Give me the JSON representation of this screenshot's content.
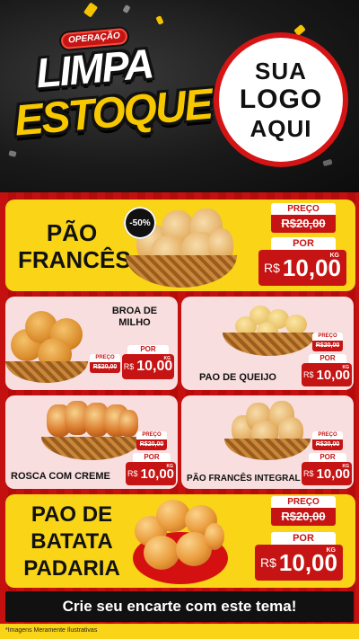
{
  "header": {
    "badge": "OPERAÇÃO",
    "title_line1": "LIMPA",
    "title_line2": "ESTOQUE",
    "logo": [
      "SUA",
      "LOGO",
      "AQUI"
    ]
  },
  "labels": {
    "preco": "PREÇO",
    "por": "POR",
    "currency": "R$",
    "unit": "KG"
  },
  "products": {
    "pao_frances": {
      "name_l1": "PÃO",
      "name_l2": "FRANCÊS",
      "discount": "-50%",
      "old_price": "R$20,00",
      "new_price": "10,00"
    },
    "broa": {
      "name_l1": "BROA DE",
      "name_l2": "MILHO",
      "old_price": "R$20,00",
      "new_price": "10,00"
    },
    "pao_queijo": {
      "name": "PAO DE QUEIJO",
      "old_price": "R$20,00",
      "new_price": "10,00"
    },
    "rosca": {
      "name": "ROSCA COM CREME",
      "old_price": "R$20,00",
      "new_price": "10,00"
    },
    "pao_integral": {
      "name": "PÃO FRANCÊS INTEGRAL",
      "old_price": "R$20,00",
      "new_price": "10,00"
    },
    "pao_batata": {
      "name_l1": "PAO DE",
      "name_l2": "BATATA",
      "name_l3": "PADARIA",
      "old_price": "R$20,00",
      "new_price": "10,00"
    }
  },
  "footer": {
    "cta": "Crie seu encarte com este tema!",
    "disclaimer": "*Imagens Meramente Ilustrativas"
  },
  "colors": {
    "red": "#c61414",
    "yellow": "#f9d417",
    "pink": "#f8dede",
    "black": "#111111"
  }
}
